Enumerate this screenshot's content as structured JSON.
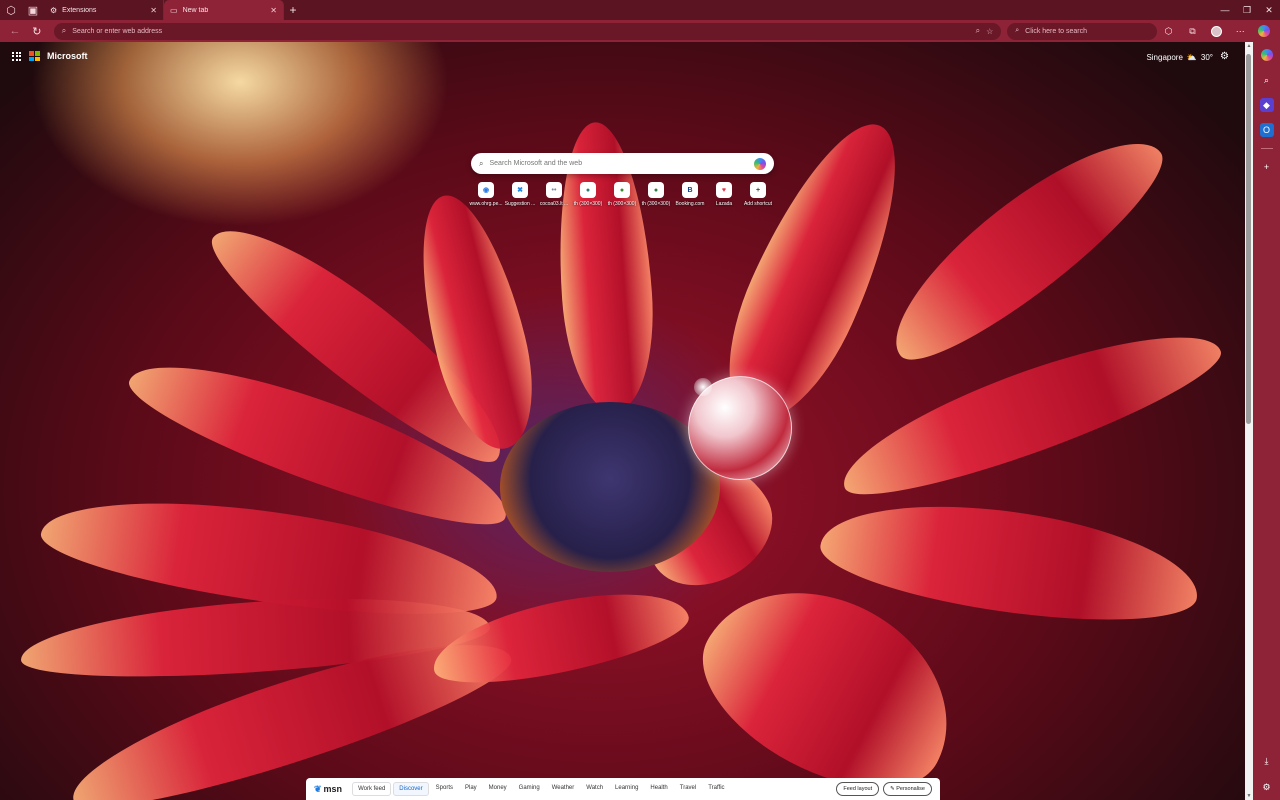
{
  "browser": {
    "tabs": [
      {
        "label": "Extensions",
        "favicon": "puzzle-icon",
        "active": false
      },
      {
        "label": "New tab",
        "favicon": "page-icon",
        "active": true
      }
    ],
    "address_placeholder": "Search or enter web address",
    "search_placeholder": "Click here to search",
    "accent_color": "#8e2236"
  },
  "ntp": {
    "brand": "Microsoft",
    "weather": {
      "location": "Singapore",
      "temp": "30°",
      "icon": "cloud-sun-icon"
    },
    "search_placeholder": "Search Microsoft and the web",
    "shortcuts": [
      {
        "label": "www.ohrg.pe...",
        "letter": "◉",
        "color": "#2a7be4"
      },
      {
        "label": "Suggestion ...",
        "letter": "✖",
        "color": "#1e88e5"
      },
      {
        "label": "cocoa03.lt ...",
        "letter": "••",
        "color": "#7a8aa0"
      },
      {
        "label": "th (300×300)",
        "letter": "●",
        "color": "#2d7d72"
      },
      {
        "label": "th (300×300)",
        "letter": "●",
        "color": "#3a8d2f"
      },
      {
        "label": "th (300×300)",
        "letter": "●",
        "color": "#2e7d44"
      },
      {
        "label": "Booking.com",
        "letter": "B",
        "color": "#0b3f8f"
      },
      {
        "label": "Lazada",
        "letter": "♥",
        "color": "#e8344d"
      },
      {
        "label": "Add shortcut",
        "letter": "+",
        "color": "#444444"
      }
    ]
  },
  "msn": {
    "logo": "msn",
    "tabs": [
      "Work feed",
      "Discover",
      "Sports",
      "Play",
      "Money",
      "Gaming",
      "Weather",
      "Watch",
      "Learning",
      "Health",
      "Travel",
      "Traffic"
    ],
    "active_tab": "Discover",
    "feed_layout": "Feed layout",
    "personalise": "Personalise"
  }
}
